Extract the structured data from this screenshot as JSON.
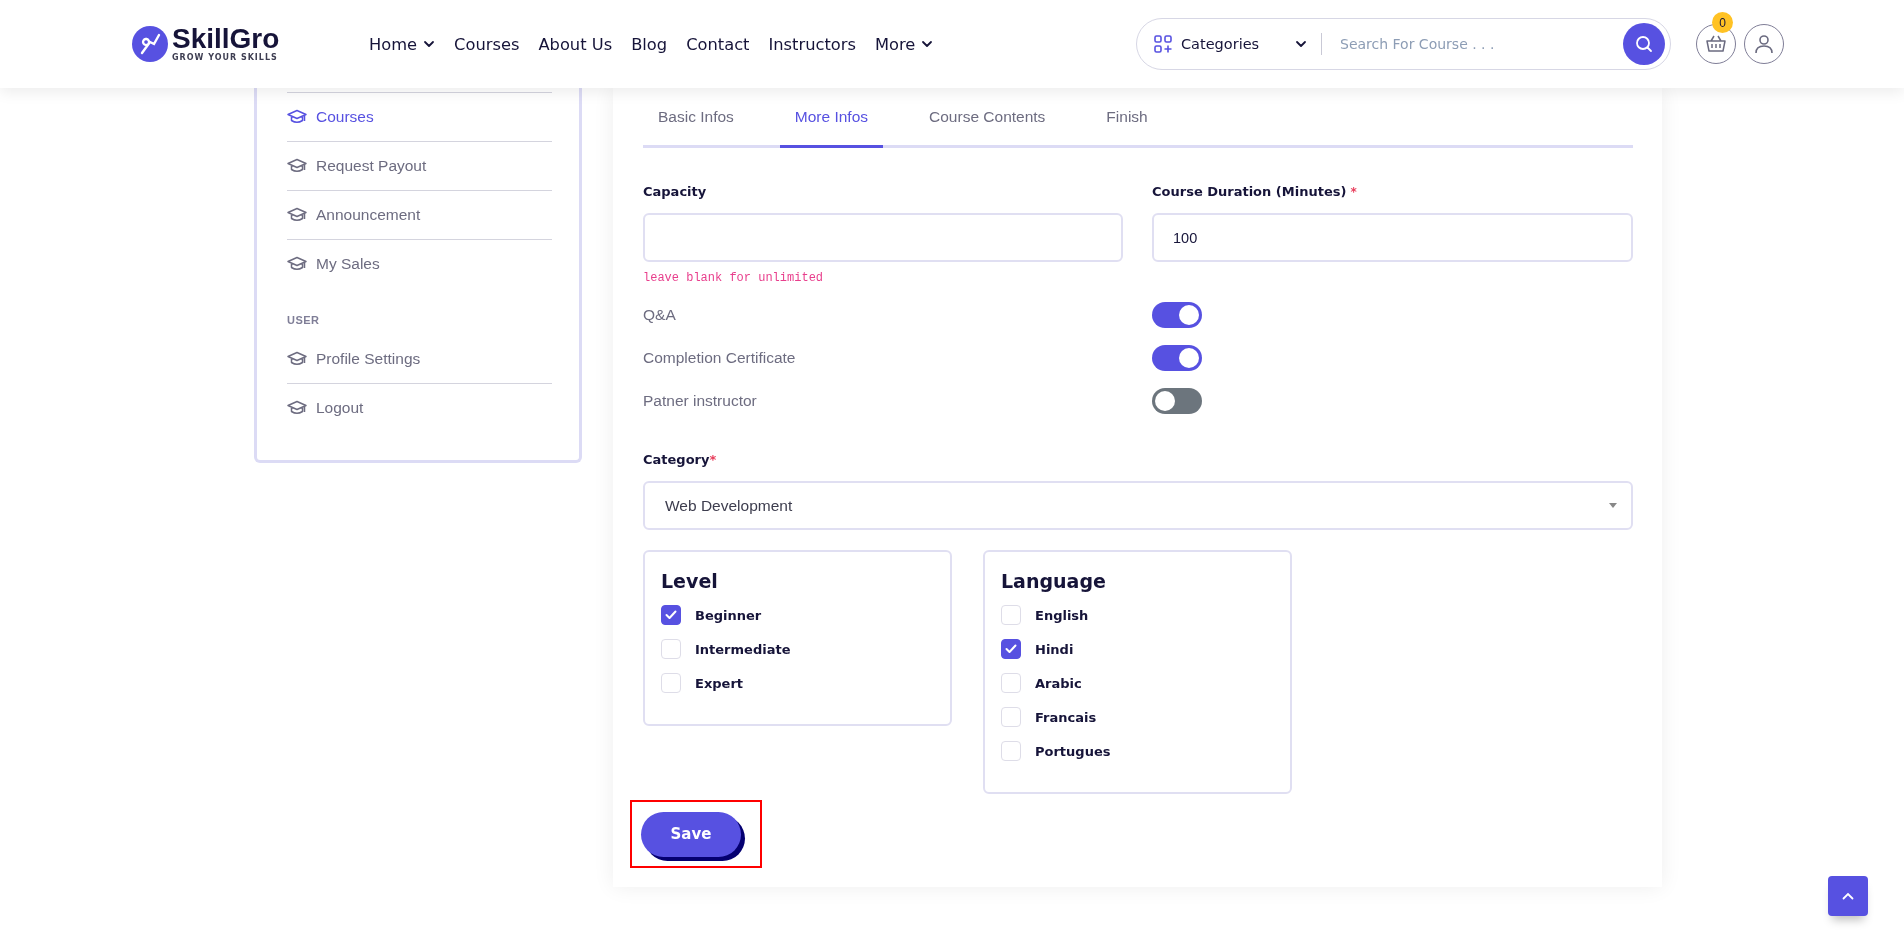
{
  "header": {
    "logo": {
      "name": "SkillGro",
      "tagline": "GROW YOUR SKILLS"
    },
    "nav": [
      {
        "label": "Home",
        "has_dropdown": true
      },
      {
        "label": "Courses",
        "has_dropdown": false
      },
      {
        "label": "About Us",
        "has_dropdown": false
      },
      {
        "label": "Blog",
        "has_dropdown": false
      },
      {
        "label": "Contact",
        "has_dropdown": false
      },
      {
        "label": "Instructors",
        "has_dropdown": false
      },
      {
        "label": "More",
        "has_dropdown": true
      }
    ],
    "search": {
      "category": "Categories",
      "placeholder": "Search For Course . . ."
    },
    "cart_count": "0"
  },
  "sidebar": {
    "sections": [
      {
        "items": [
          {
            "label": "Courses",
            "selected": true
          },
          {
            "label": "Request Payout",
            "selected": false
          },
          {
            "label": "Announcement",
            "selected": false
          },
          {
            "label": "My Sales",
            "selected": false
          }
        ]
      },
      {
        "title": "USER",
        "items": [
          {
            "label": "Profile Settings",
            "selected": false
          },
          {
            "label": "Logout",
            "selected": false
          }
        ]
      }
    ]
  },
  "tabs": [
    {
      "label": "Basic Infos",
      "selected": false
    },
    {
      "label": "More Infos",
      "selected": true
    },
    {
      "label": "Course Contents",
      "selected": false
    },
    {
      "label": "Finish",
      "selected": false
    }
  ],
  "form": {
    "capacity": {
      "label": "Capacity",
      "hint": "leave blank for unlimited"
    },
    "duration": {
      "label": "Course Duration (Minutes)",
      "required_mark": "*",
      "value": "100"
    },
    "toggles": [
      {
        "label": "Q&A",
        "on": true
      },
      {
        "label": "Completion Certificate",
        "on": true
      },
      {
        "label": "Patner instructor",
        "on": false
      }
    ],
    "category": {
      "label": "Category",
      "required_mark": "*",
      "value": "Web Development"
    },
    "option_groups": [
      {
        "title": "Level",
        "options": [
          {
            "label": "Beginner",
            "checked": true
          },
          {
            "label": "Intermediate",
            "checked": false
          },
          {
            "label": "Expert",
            "checked": false
          }
        ]
      },
      {
        "title": "Language",
        "options": [
          {
            "label": "English",
            "checked": false
          },
          {
            "label": "Hindi",
            "checked": true
          },
          {
            "label": "Arabic",
            "checked": false
          },
          {
            "label": "Francais",
            "checked": false
          },
          {
            "label": "Portugues",
            "checked": false
          }
        ]
      }
    ],
    "save_button": {
      "label": "Save",
      "highlighted": true
    }
  }
}
